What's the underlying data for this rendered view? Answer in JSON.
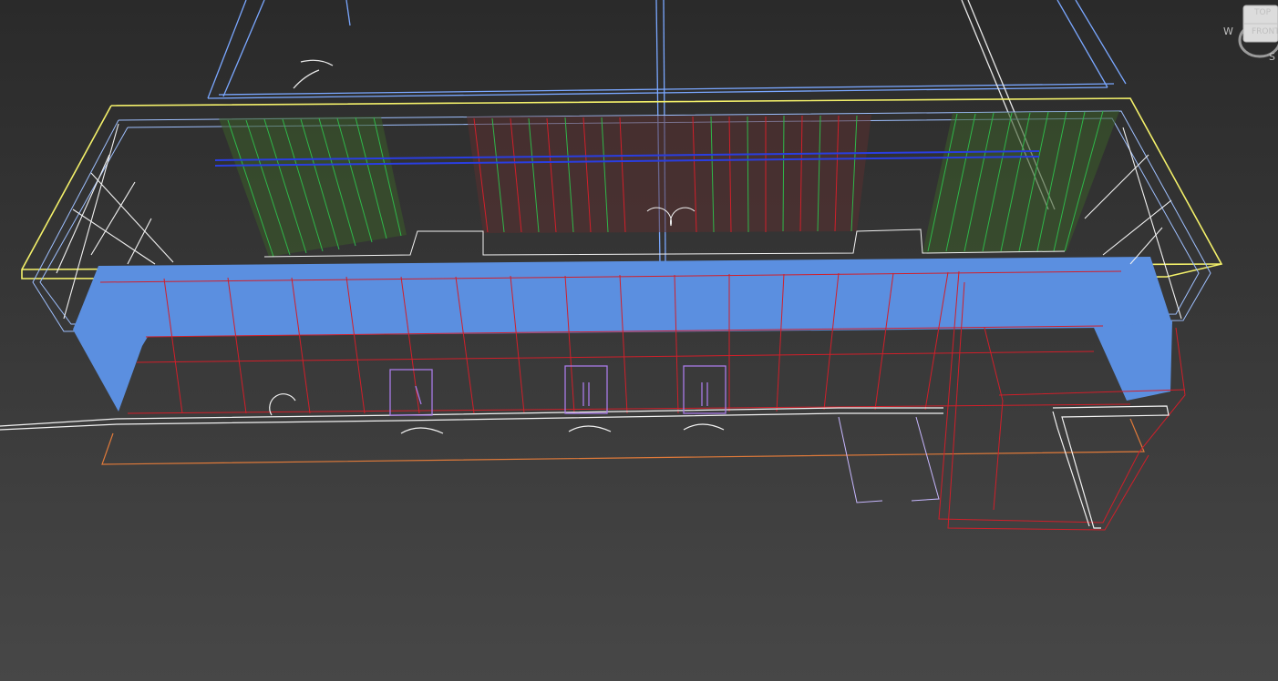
{
  "app": {
    "name": ""
  },
  "viewport": {
    "background": "#373737",
    "render_mode": "wireframe"
  },
  "viewcube": {
    "faces": [
      "TOP",
      "FRONT"
    ],
    "compass": {
      "w": "W",
      "s": "S"
    }
  },
  "colors": {
    "selection_yellow": "#f3f06a",
    "wall_blue": "#5b8fe0",
    "frame_red": "#d11f2a",
    "seat_green": "#2fb74a",
    "door_white": "#f2f2f2",
    "door_purple": "#a97be8",
    "outline_orange": "#e07a3a",
    "outline_lightblue": "#7aa7ff"
  }
}
